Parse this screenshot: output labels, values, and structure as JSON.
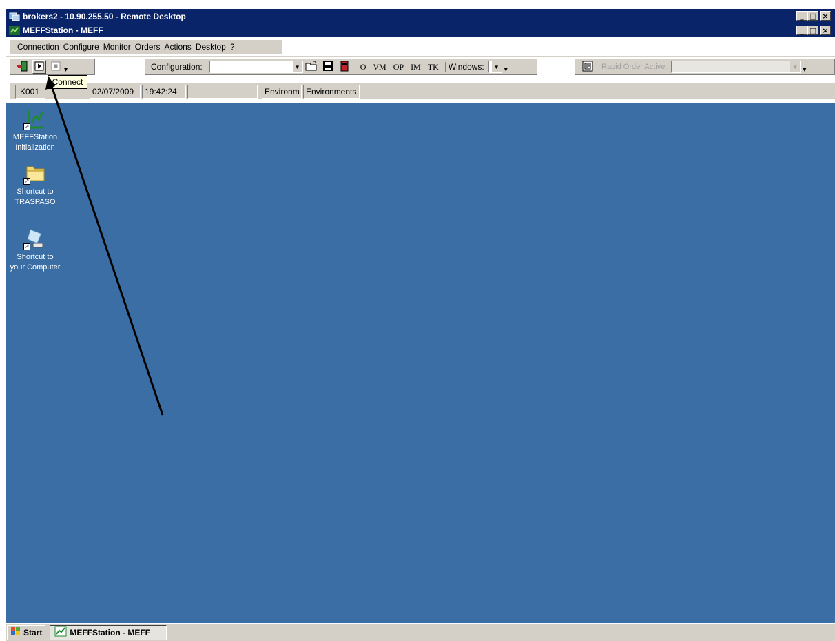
{
  "remote_desktop": {
    "title": "brokers2 - 10.90.255.50 - Remote Desktop"
  },
  "app": {
    "title": "MEFFStation - MEFF"
  },
  "menu": [
    "Connection",
    "Configure",
    "Monitor",
    "Orders",
    "Actions",
    "Desktop",
    "?"
  ],
  "toolbar": {
    "configuration_label": "Configuration:",
    "configuration_value": "",
    "short_buttons": [
      "O",
      "VM",
      "OP",
      "IM",
      "TK"
    ],
    "windows_label": "Windows:",
    "rapid_order_label": "Rapid Order Active:",
    "rapid_order_value": ""
  },
  "tooltip": {
    "text": "Connect"
  },
  "status": {
    "user": "K001",
    "date": "02/07/2009",
    "time": "19:42:24",
    "env_truncated": "Environm",
    "environments": "Environments"
  },
  "desktop_icons": [
    {
      "line1": "MEFFStation",
      "line2": "Initialization",
      "icon": "meffstation-icon"
    },
    {
      "line1": "Shortcut to",
      "line2": "TRASPASO",
      "icon": "folder-icon"
    },
    {
      "line1": "Shortcut to",
      "line2": "your Computer",
      "icon": "computer-icon"
    }
  ],
  "taskbar": {
    "start_label": "Start",
    "task_label": "MEFFStation - MEFF"
  },
  "colors": {
    "desktop": "#3a6ea5",
    "titlebar": "#0a246a",
    "chrome": "#d4d0c8",
    "tooltip": "#ffffe1"
  }
}
